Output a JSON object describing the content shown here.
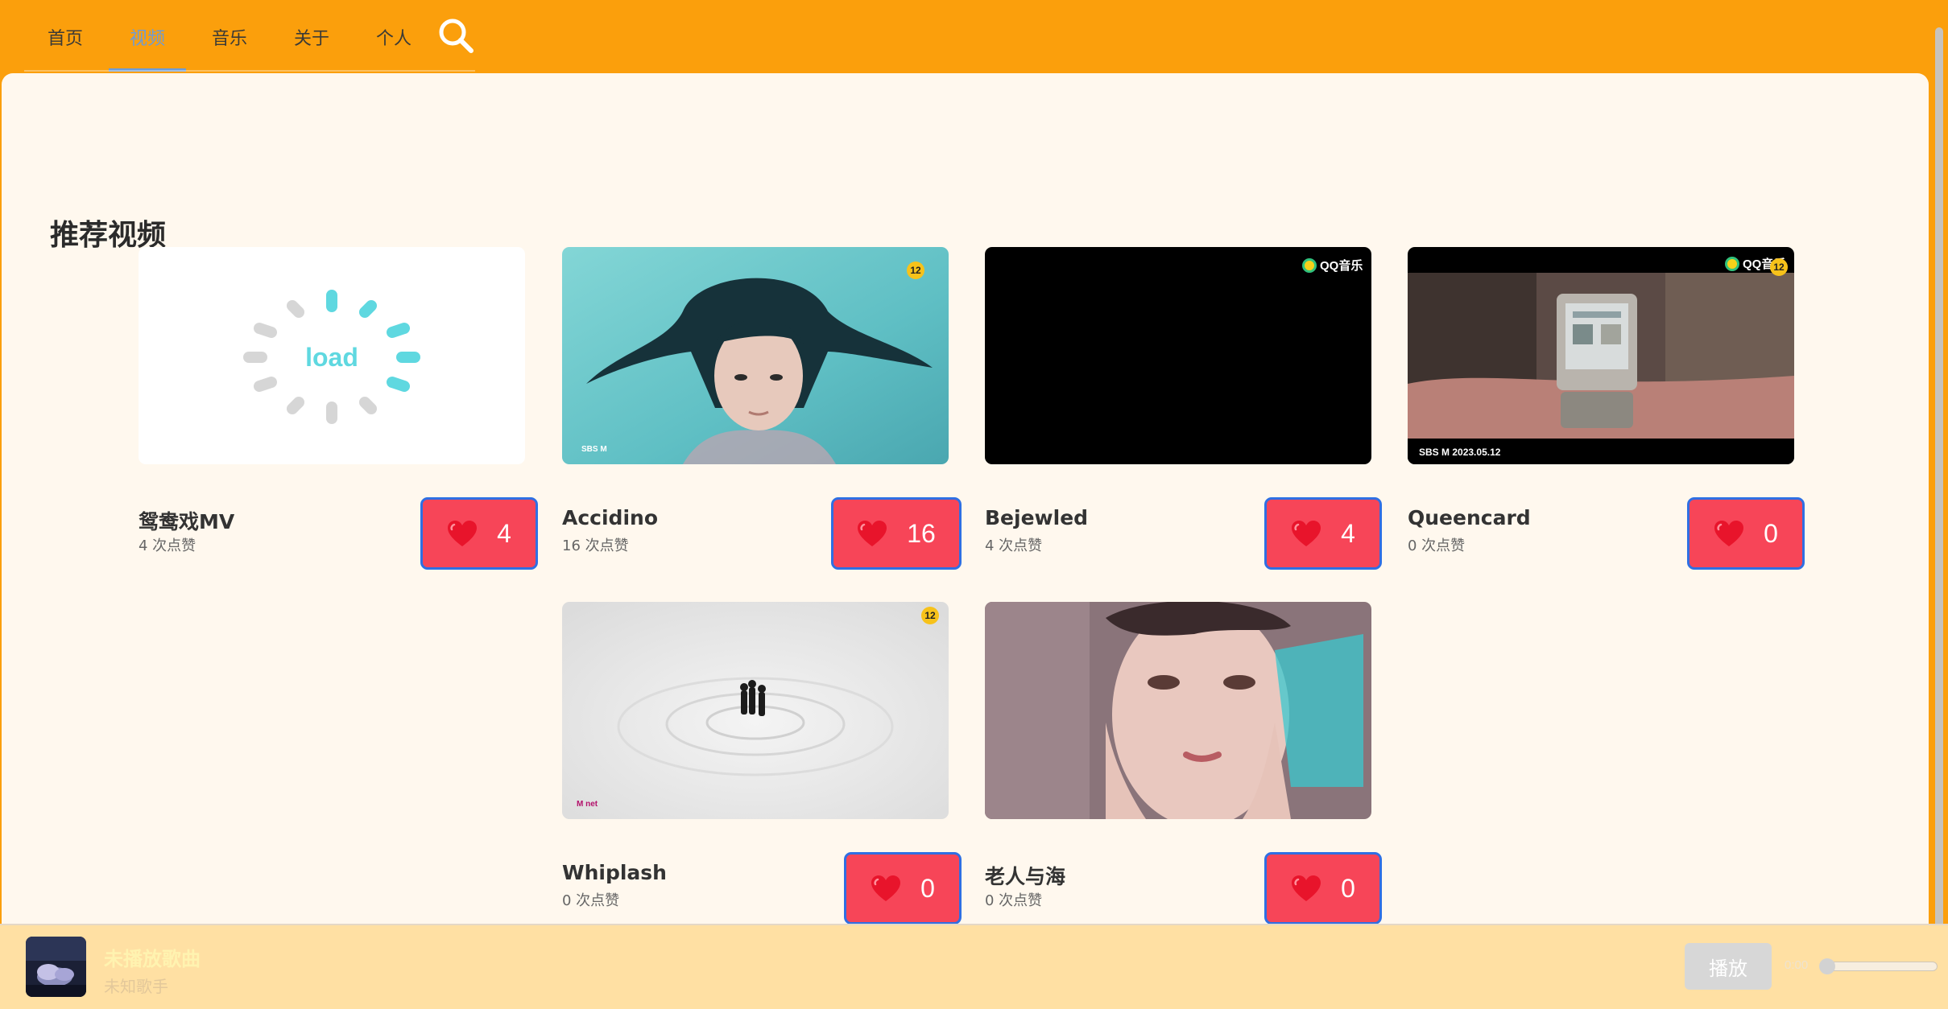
{
  "nav": {
    "items": [
      {
        "label": "首页",
        "active": false
      },
      {
        "label": "视频",
        "active": true
      },
      {
        "label": "音乐",
        "active": false
      },
      {
        "label": "关于",
        "active": false
      },
      {
        "label": "个人",
        "active": false
      }
    ],
    "search_icon": "search-icon",
    "accent_color": "#fb9f0c",
    "active_color": "#6d9bd6"
  },
  "section_title": "推荐视频",
  "videos": [
    {
      "title": "鸳鸯戏MV",
      "likes_text": "4 次点赞",
      "like_count": "4",
      "thumbnail": "loading",
      "loading_text": "load"
    },
    {
      "title": "Accidino",
      "likes_text": "16 次点赞",
      "like_count": "16",
      "thumbnail": "water-portrait"
    },
    {
      "title": "Bejewled",
      "likes_text": "4 次点赞",
      "like_count": "4",
      "thumbnail": "black"
    },
    {
      "title": "Queencard",
      "likes_text": "0 次点赞",
      "like_count": "0",
      "thumbnail": "flip-phone"
    },
    {
      "title": "Whiplash",
      "likes_text": "0 次点赞",
      "like_count": "0",
      "thumbnail": "snow-dancers"
    },
    {
      "title": "老人与海",
      "likes_text": "0 次点赞",
      "like_count": "0",
      "thumbnail": "portrait-hands"
    }
  ],
  "watermarks": {
    "qq_music": "QQ音乐",
    "sbs_date": "2023.05.12",
    "sbs": "SBS M",
    "mnet": "M net",
    "age_badge": "12"
  },
  "like_button_color": "#f74558",
  "player": {
    "song_title": "未播放歌曲",
    "artist": "未知歌手",
    "play_label": "播放",
    "time": "0:00",
    "progress": 0
  }
}
